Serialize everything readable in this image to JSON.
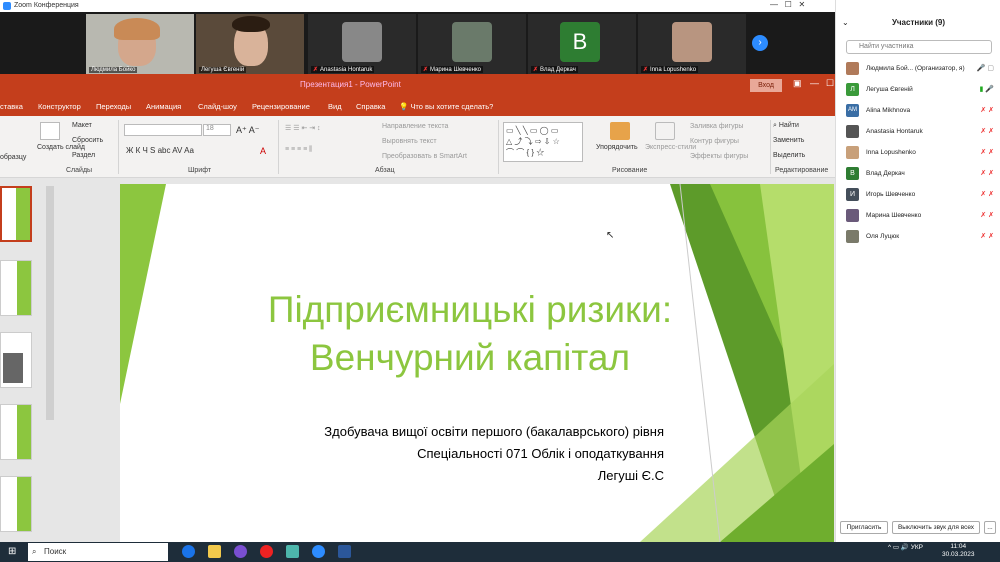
{
  "zoom": {
    "title": "Zoom Конференция"
  },
  "videos": [
    {
      "name": "Людмила Бойко",
      "muted": false
    },
    {
      "name": "Легуша Євгеній",
      "muted": false
    },
    {
      "name": "Anastasia Hontaruk",
      "muted": true
    },
    {
      "name": "Марина Шевченко",
      "muted": true
    },
    {
      "name": "Влад Деркач",
      "muted": true,
      "initial": "B"
    },
    {
      "name": "Inna Lopushenko",
      "muted": true
    }
  ],
  "ppt": {
    "filename": "Презентация1  -  PowerPoint",
    "signin": "Вход",
    "tabs": [
      "ставка",
      "Конструктор",
      "Переходы",
      "Анимация",
      "Слайд-шоу",
      "Рецензирование",
      "Вид",
      "Справка",
      "Что вы хотите сделать?"
    ],
    "ribbon": {
      "create_slide": "Создать слайд",
      "obrazcu": "образцу",
      "maket": "Макет",
      "sbrosit": "Сбросить",
      "razdel": "Раздел",
      "group_slides": "Слайды",
      "group_font": "Шрифт",
      "font_size": "18",
      "font_buttons": "Ж  К  Ч  S  abc  AV  Aa",
      "group_paragraph": "Абзац",
      "text_direction": "Направление текста",
      "align_text": "Выровнять текст",
      "smartart": "Преобразовать в SmartArt",
      "arrange": "Упорядочить",
      "quick_styles": "Экспресс-стили",
      "fill": "Заливка фигуры",
      "outline": "Контур фигуры",
      "effects": "Эффекты фигуры",
      "group_drawing": "Рисование",
      "find": "Найти",
      "replace": "Заменить",
      "select": "Выделить",
      "group_editing": "Редактирование"
    },
    "slide": {
      "title_line1": "Підприємницькі ризики:",
      "title_line2": "Венчурний капітал",
      "sub1": "Здобувача вищої освіти першого (бакалаврського) рівня",
      "sub2": "Спеціальності 071 Облік і оподаткування",
      "sub3": "Легуші Є.С"
    }
  },
  "participants": {
    "title": "Участники (9)",
    "search_placeholder": "Найти участника",
    "list": [
      {
        "name": "Людмила Бой... (Организатор, я)",
        "color": "#b07a5a",
        "initial": ""
      },
      {
        "name": "Легуша Євгеній",
        "color": "#3a9a3a",
        "initial": "Л"
      },
      {
        "name": "Alina Mikhnova",
        "color": "#3a6ea5",
        "initial": "AM"
      },
      {
        "name": "Anastasia Hontaruk",
        "color": "#555",
        "initial": ""
      },
      {
        "name": "Inna Lopushenko",
        "color": "#c8a07a",
        "initial": ""
      },
      {
        "name": "Влад Деркач",
        "color": "#2e7d32",
        "initial": "B"
      },
      {
        "name": "Игорь Шевченко",
        "color": "#444e5a",
        "initial": "И"
      },
      {
        "name": "Марина Шевченко",
        "color": "#6a5a7a",
        "initial": ""
      },
      {
        "name": "Оля Луцюк",
        "color": "#7a7a6a",
        "initial": ""
      }
    ],
    "invite": "Пригласить",
    "mute_all": "Выключить звук для всех",
    "more": "..."
  },
  "taskbar": {
    "search": "Поиск",
    "lang": "УКР",
    "time": "11:04",
    "date": "30.03.2023"
  },
  "colors": {
    "ppt_red": "#c43e1c",
    "slide_green": "#8cc63f",
    "zoom_blue": "#2d8cff"
  }
}
